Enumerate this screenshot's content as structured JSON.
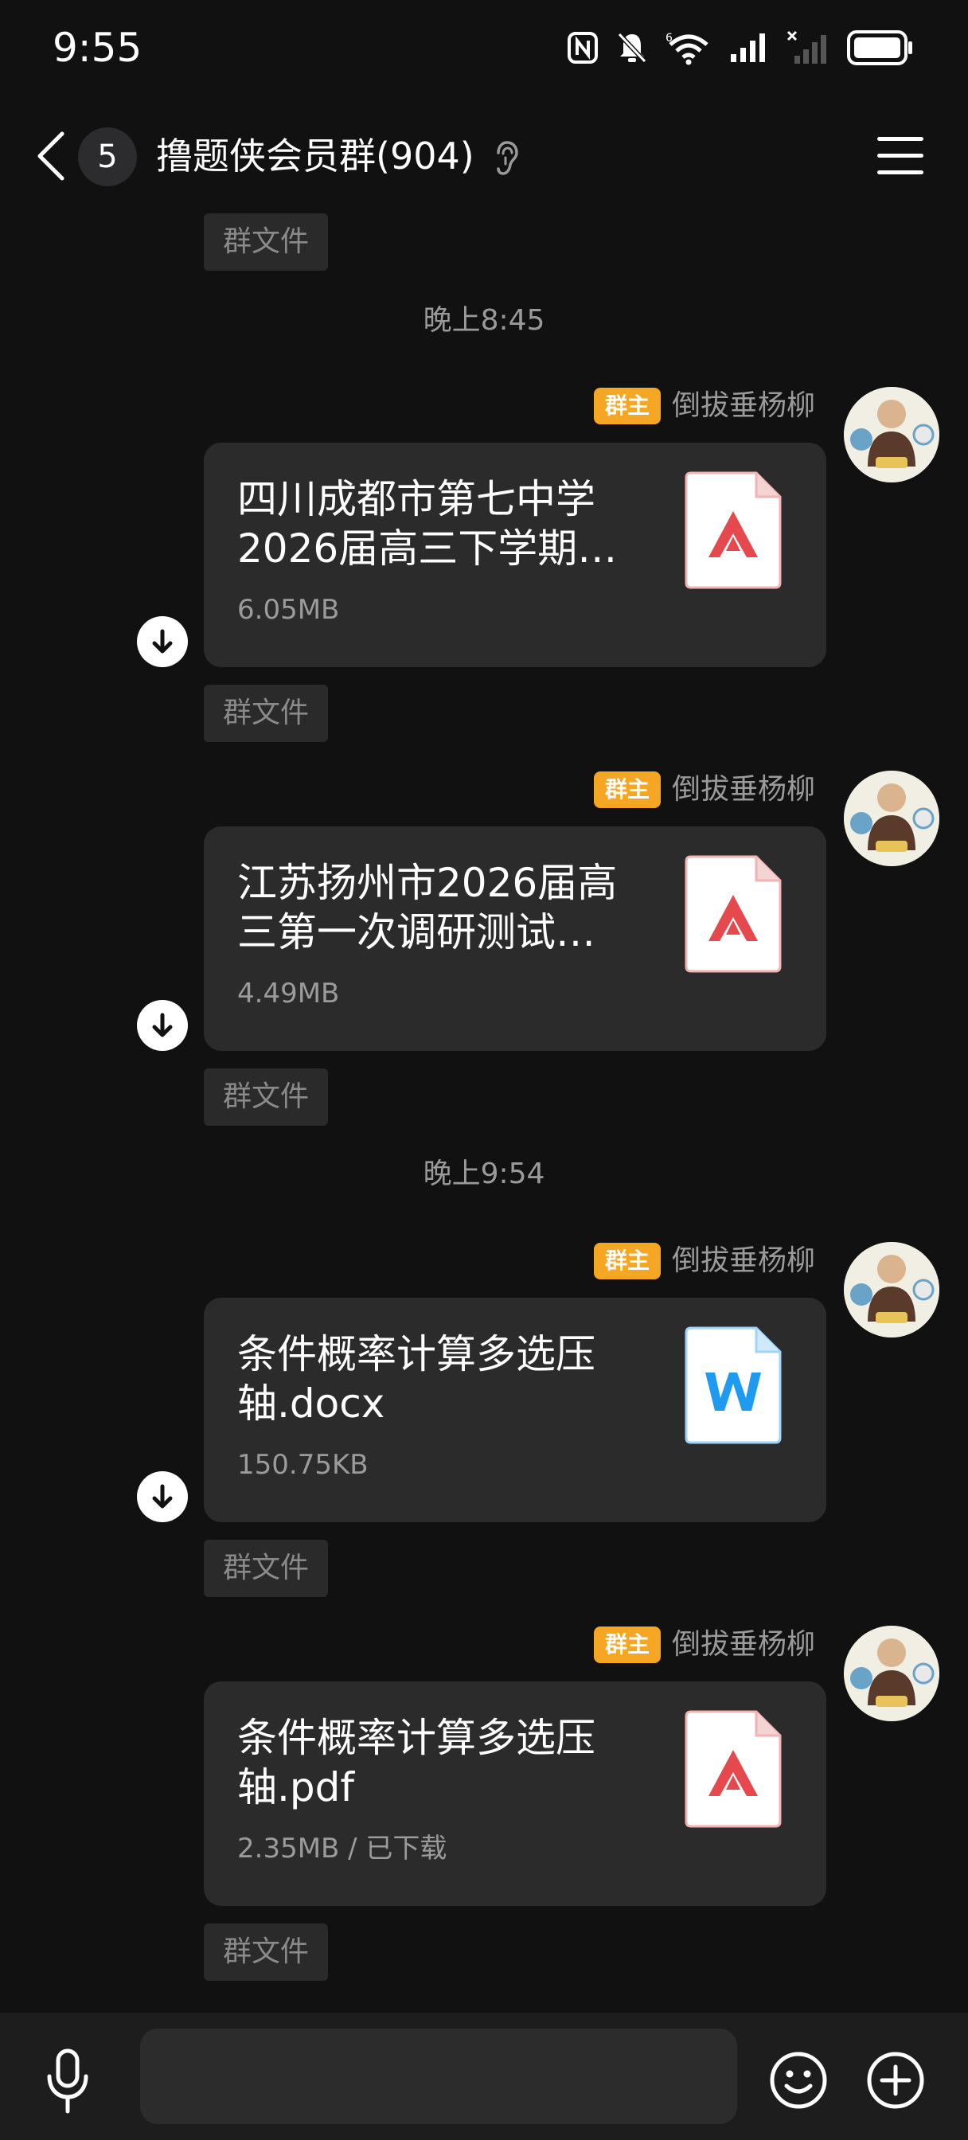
{
  "status_bar": {
    "time": "9:55",
    "icons": [
      "nfc-icon",
      "mute-icon",
      "wifi-icon",
      "signal-icon",
      "signal-x-icon",
      "battery-icon"
    ]
  },
  "header": {
    "unread_count": "5",
    "title": "撸题侠会员群(904)"
  },
  "labels": {
    "group_file": "群文件",
    "owner_badge": "群主",
    "sender": "倒拔垂杨柳"
  },
  "timestamps": [
    "晚上8:45",
    "晚上9:54"
  ],
  "messages": [
    {
      "name_line1": "四川成都市第七中学",
      "name_line2": "2026届高三下学期…",
      "size": "6.05MB",
      "type": "pdf"
    },
    {
      "name_line1": "江苏扬州市2026届高",
      "name_line2": "三第一次调研测试…",
      "size": "4.49MB",
      "type": "pdf"
    },
    {
      "name_line1": "条件概率计算多选压",
      "name_line2": "轴.docx",
      "size": "150.75KB",
      "type": "word"
    },
    {
      "name_line1": "条件概率计算多选压",
      "name_line2": "轴.pdf",
      "size": "2.35MB / 已下载",
      "type": "pdf"
    }
  ],
  "colors": {
    "background": "#111111",
    "card": "#2b2b2b",
    "owner_badge": "#f5a623",
    "pdf_red": "#e5484d",
    "word_blue": "#1e9bf0"
  }
}
